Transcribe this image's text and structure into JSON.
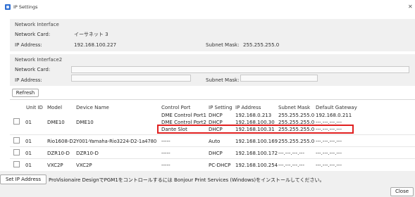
{
  "window": {
    "title": "IP Settings",
    "close_glyph": "✕"
  },
  "network_interface": {
    "title": "Network Interface",
    "card_label": "Network Card:",
    "card_value": "イーサネット 3",
    "ip_label": "IP Address:",
    "ip_value": "192.168.100.227",
    "mask_label": "Subnet Mask:",
    "mask_value": "255.255.255.0"
  },
  "network_interface2": {
    "title": "Network Interface2",
    "card_label": "Network Card:",
    "card_value": "",
    "ip_label": "IP Address:",
    "ip_value": "",
    "mask_label": "Subnet Mask:",
    "mask_value": ""
  },
  "refresh_label": "Refresh",
  "table": {
    "headers": [
      "Unit ID",
      "Model",
      "Device Name",
      "Control Port",
      "IP Setting",
      "IP Address",
      "Subnet Mask",
      "Default Gateway"
    ],
    "rows": [
      {
        "unit_id": "01",
        "model": "DME10",
        "device_name": "DME10",
        "ports": [
          {
            "control_port": "DME Control Port1",
            "ip_setting": "DHCP",
            "ip_address": "192.168.0.213",
            "subnet_mask": "255.255.255.0",
            "gateway": "192.168.0.211"
          },
          {
            "control_port": "DME Control Port2",
            "ip_setting": "DHCP",
            "ip_address": "192.168.100.30",
            "subnet_mask": "255.255.255.0",
            "gateway": "---.---.---.---"
          },
          {
            "control_port": "Dante Slot",
            "ip_setting": "DHCP",
            "ip_address": "192.168.100.31",
            "subnet_mask": "255.255.255.0",
            "gateway": "---.---.---.---"
          }
        ]
      },
      {
        "unit_id": "01",
        "model": "Rio1608-D2",
        "device_name": "Y001-Yamaha-Rio3224-D2-1a4780",
        "control_port": "-----",
        "ip_setting": "Auto",
        "ip_address": "192.168.100.169",
        "subnet_mask": "255.255.255.0",
        "gateway": "---.---.---.---"
      },
      {
        "unit_id": "01",
        "model": "DZR10-D",
        "device_name": "DZR10-D",
        "control_port": "-----",
        "ip_setting": "DHCP",
        "ip_address": "192.168.100.172",
        "subnet_mask": "---.---.---.---",
        "gateway": "---.---.---.---"
      },
      {
        "unit_id": "01",
        "model": "VXC2P",
        "device_name": "VXC2P",
        "control_port": "-----",
        "ip_setting": "PC-DHCP",
        "ip_address": "192.168.100.254",
        "subnet_mask": "---.---.---.---",
        "gateway": "---.---.---.---"
      }
    ]
  },
  "footer": {
    "set_ip_label": "Set IP Address",
    "note": "ProVisionaire DesignでPGM1をコントロールするには Bonjour Print Services (Windows)をインストールしてください。",
    "close_label": "Close"
  },
  "colors": {
    "accent": "#2f6fd3",
    "highlight": "#e02020",
    "panel": "#f0f0f0"
  }
}
